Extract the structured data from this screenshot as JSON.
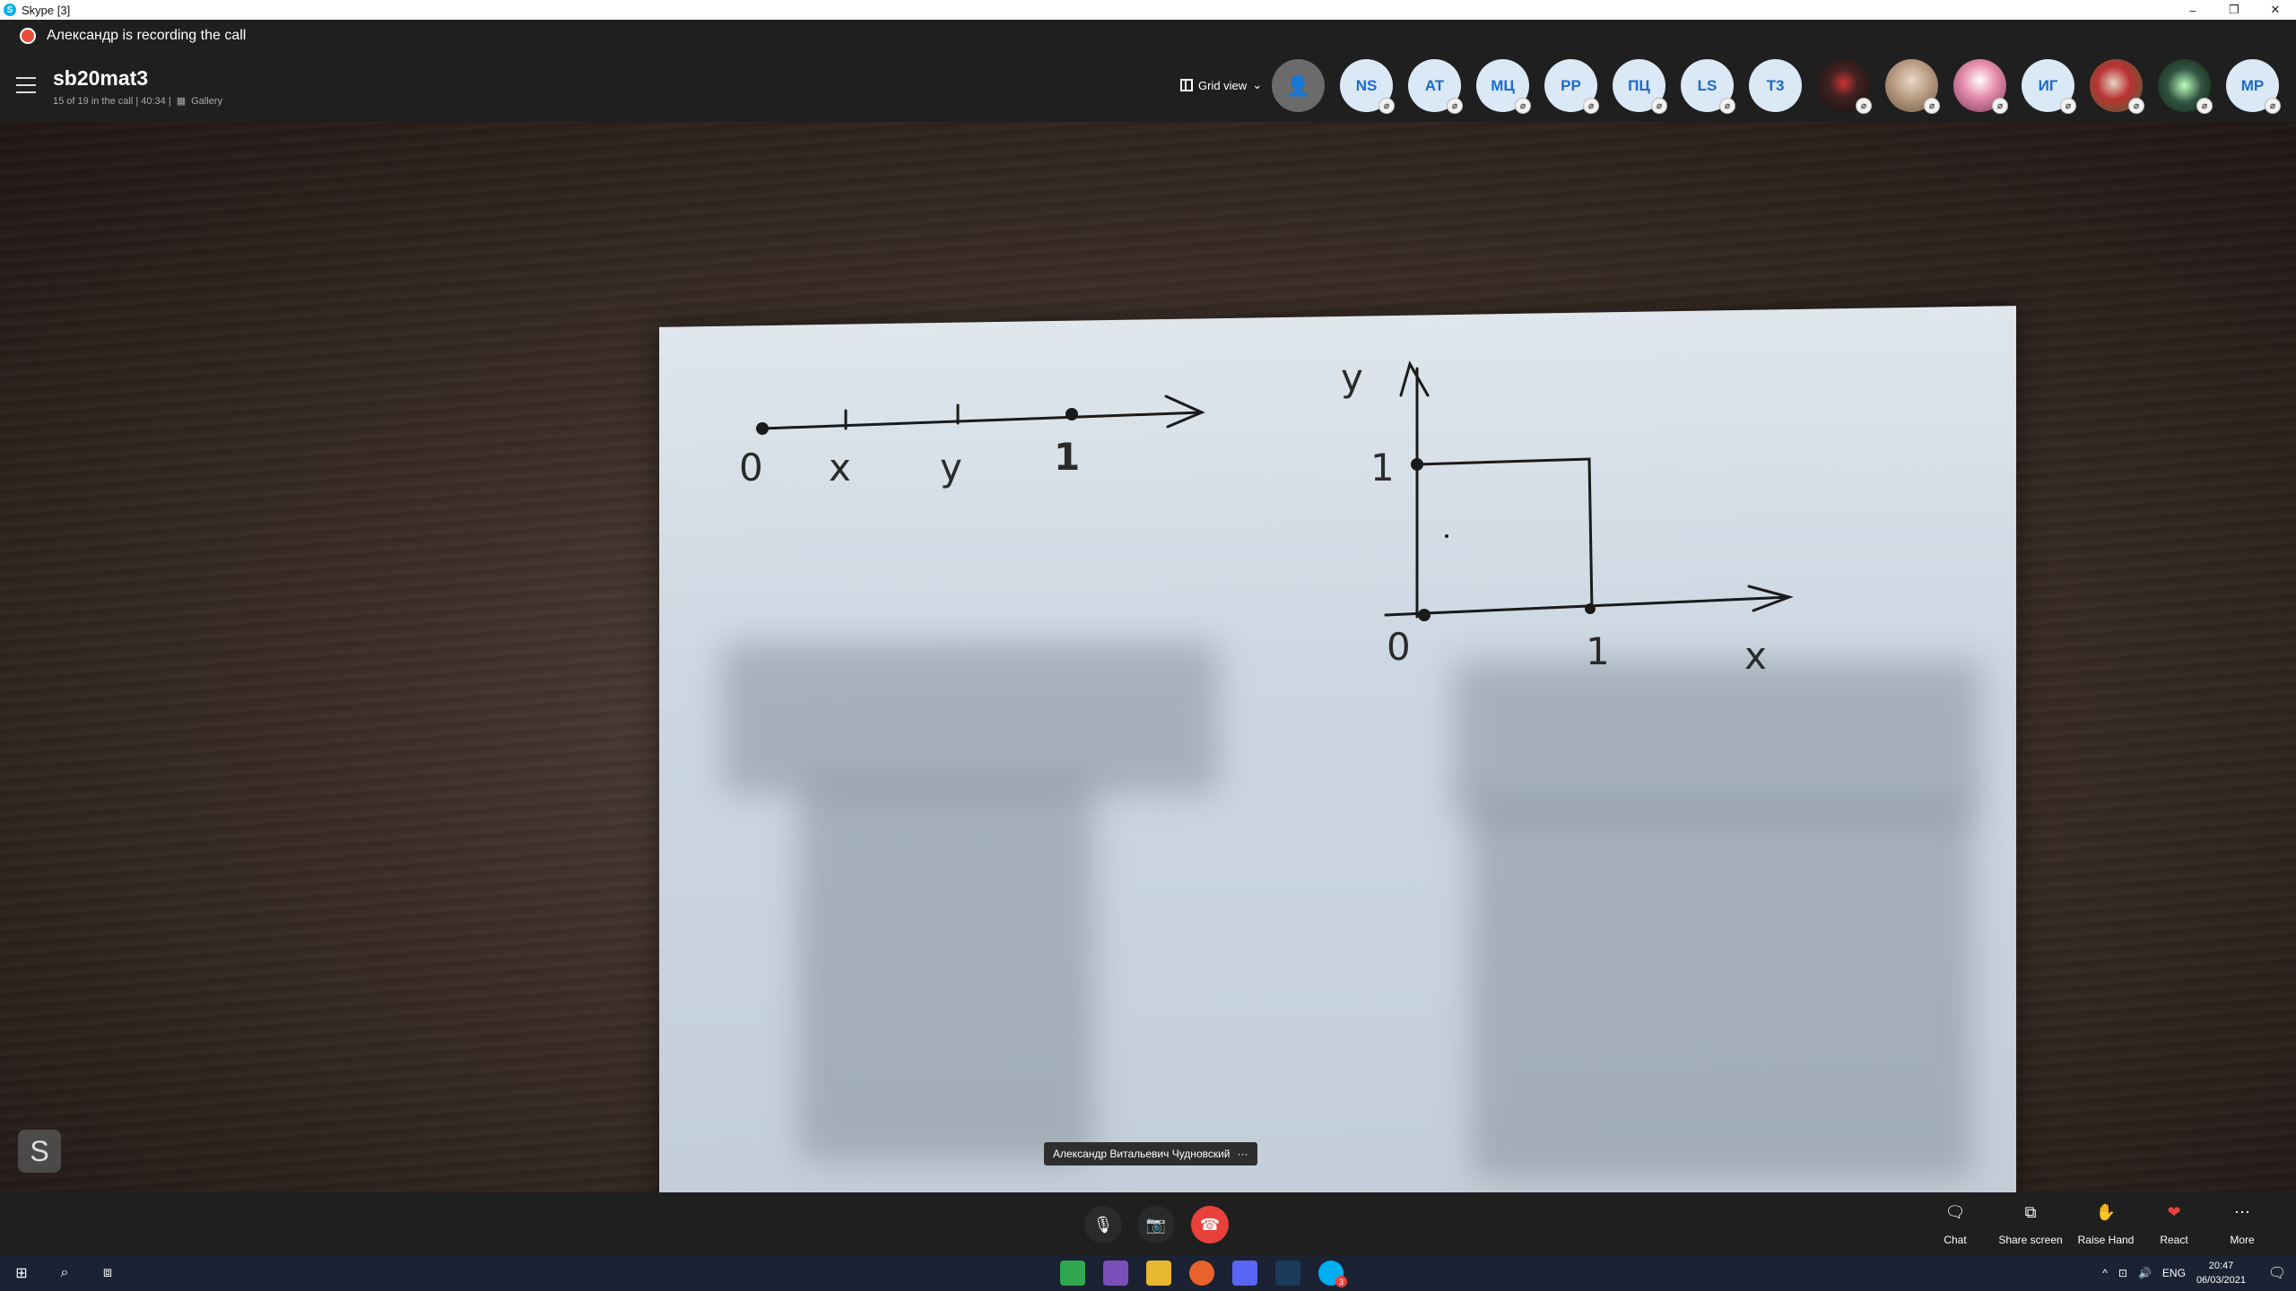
{
  "window": {
    "title": "Skype [3]",
    "controls": [
      "–",
      "❐",
      "✕"
    ]
  },
  "recording": {
    "text": "Александр is recording the call"
  },
  "header": {
    "title": "sb20mat3",
    "subtitle": "15 of 19 in the call | 40:34 |",
    "gallery_label": "Gallery",
    "grid_view_label": "Grid view"
  },
  "participants": [
    {
      "initials": "NS"
    },
    {
      "initials": "AT"
    },
    {
      "initials": "МЦ"
    },
    {
      "initials": "PP"
    },
    {
      "initials": "ПЦ"
    },
    {
      "initials": "LS"
    },
    {
      "initials": "T3"
    },
    {
      "initials": ""
    },
    {
      "initials": ""
    },
    {
      "initials": ""
    },
    {
      "initials": "ИГ"
    },
    {
      "initials": ""
    },
    {
      "initials": ""
    },
    {
      "initials": "MP"
    }
  ],
  "video": {
    "speaker_name": "Александр Витальевич Чудновский",
    "speaker_menu": "···",
    "s_badge": "S",
    "sketch_labels": {
      "line_0": "0",
      "line_x": "x",
      "line_y": "y",
      "line_1": "1",
      "axis_y": "y",
      "axis_1": "1",
      "origin": "0",
      "axis_x1": "1",
      "axis_x": "x"
    }
  },
  "controls": {
    "chat_label": "Chat",
    "share_label": "Share screen",
    "raise_label": "Raise Hand",
    "react_label": "React",
    "more_label": "More"
  },
  "taskbar": {
    "language": "ENG",
    "time": "20:47",
    "date": "06/03/2021",
    "skype_badge": "3"
  },
  "colors": {
    "end_call": "#e8413a",
    "participant_text": "#1b6ad0",
    "participant_bg": "#dbe8f5",
    "react_heart": "#e8413a"
  }
}
